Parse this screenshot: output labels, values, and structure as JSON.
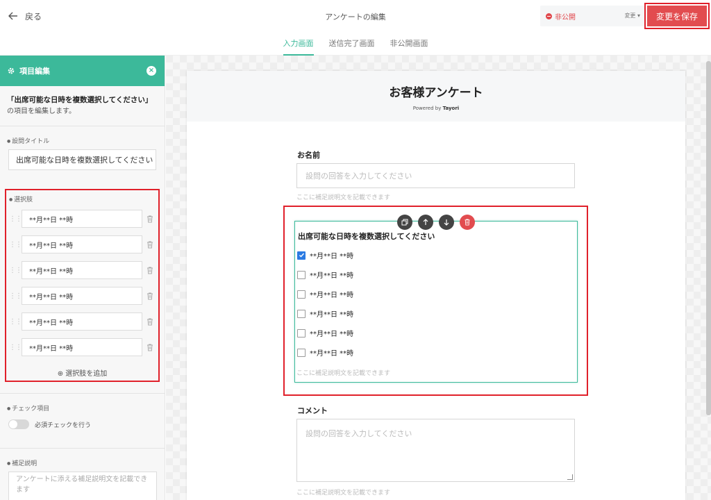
{
  "header": {
    "back_label": "戻る",
    "title": "アンケートの編集",
    "status_label": "非公開",
    "status_change": "変更 ▾",
    "save_label": "変更を保存",
    "tabs": [
      "入力画面",
      "送信完了画面",
      "非公開画面"
    ]
  },
  "sidebar": {
    "title": "項目編集",
    "close": "×",
    "target_question": "「出席可能な日時を複数選択してください」",
    "target_suffix": "の項目を編集します。",
    "question_title_label": "設問タイトル",
    "question_title_value": "出席可能な日時を複数選択してください",
    "choices_label": "選択肢",
    "choices": [
      "**月**日 **時",
      "**月**日 **時",
      "**月**日 **時",
      "**月**日 **時",
      "**月**日 **時",
      "**月**日 **時"
    ],
    "add_choice": "⊕ 選択肢を追加",
    "check_label": "チェック項目",
    "required_label": "必須チェックを行う",
    "note_label": "補足説明",
    "note_placeholder": "アンケートに添える補足説明文を記載できます"
  },
  "form": {
    "title": "お客様アンケート",
    "powered_prefix": "Powered by",
    "powered_brand": "Tayori",
    "name_label": "お名前",
    "name_placeholder": "設問の回答を入力してください",
    "note_hint": "ここに補足説明文を記載できます",
    "multi_label": "出席可能な日時を複数選択してください",
    "options": [
      "**月**日 **時",
      "**月**日 **時",
      "**月**日 **時",
      "**月**日 **時",
      "**月**日 **時",
      "**月**日 **時"
    ],
    "options_checked": [
      true,
      false,
      false,
      false,
      false,
      false
    ],
    "comment_label": "コメント",
    "comment_placeholder": "設問の回答を入力してください"
  },
  "colors": {
    "accent": "#3cb99a",
    "save": "#e24c4f",
    "highlight": "#e0202a",
    "checkbox": "#2a7ae2"
  }
}
